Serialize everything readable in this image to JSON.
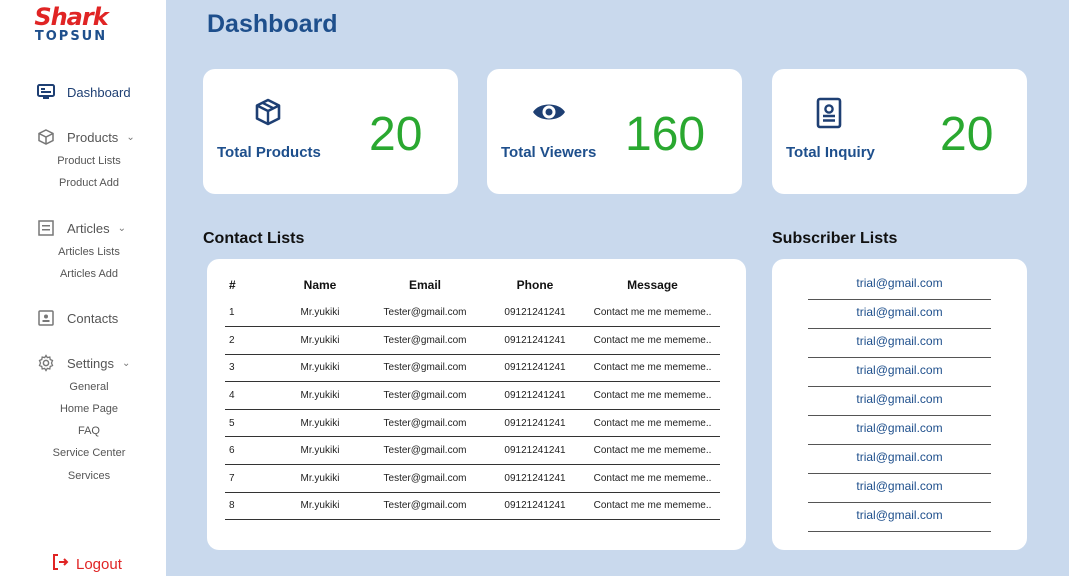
{
  "logo": {
    "main": "Shark",
    "sub": "TOPSUN"
  },
  "sidebar": {
    "items": [
      {
        "label": "Dashboard",
        "icon": "dashboard-monitor-icon"
      },
      {
        "label": "Products",
        "icon": "box-icon",
        "sub": [
          "Product Lists",
          "Product Add"
        ]
      },
      {
        "label": "Articles",
        "icon": "article-icon",
        "sub": [
          "Articles Lists",
          "Articles Add"
        ]
      },
      {
        "label": "Contacts",
        "icon": "contact-card-icon"
      },
      {
        "label": "Settings",
        "icon": "gear-icon",
        "sub": [
          "General",
          "Home Page",
          "FAQ",
          "Service Center",
          "Services"
        ]
      }
    ],
    "logout": "Logout"
  },
  "page": {
    "title": "Dashboard"
  },
  "cards": [
    {
      "label": "Total Products",
      "value": "20",
      "icon": "box-icon"
    },
    {
      "label": "Total Viewers",
      "value": "160",
      "icon": "eye-icon"
    },
    {
      "label": "Total Inquiry",
      "value": "20",
      "icon": "clipboard-user-icon"
    }
  ],
  "contacts": {
    "title": "Contact Lists",
    "columns": [
      "#",
      "Name",
      "Email",
      "Phone",
      "Message"
    ],
    "rows": [
      [
        "1",
        "Mr.yukiki",
        "Tester@gmail.com",
        "09121241241",
        "Contact me me mememe.."
      ],
      [
        "2",
        "Mr.yukiki",
        "Tester@gmail.com",
        "09121241241",
        "Contact me me mememe.."
      ],
      [
        "3",
        "Mr.yukiki",
        "Tester@gmail.com",
        "09121241241",
        "Contact me me mememe.."
      ],
      [
        "4",
        "Mr.yukiki",
        "Tester@gmail.com",
        "09121241241",
        "Contact me me mememe.."
      ],
      [
        "5",
        "Mr.yukiki",
        "Tester@gmail.com",
        "09121241241",
        "Contact me me mememe.."
      ],
      [
        "6",
        "Mr.yukiki",
        "Tester@gmail.com",
        "09121241241",
        "Contact me me mememe.."
      ],
      [
        "7",
        "Mr.yukiki",
        "Tester@gmail.com",
        "09121241241",
        "Contact me me mememe.."
      ],
      [
        "8",
        "Mr.yukiki",
        "Tester@gmail.com",
        "09121241241",
        "Contact me me mememe.."
      ]
    ]
  },
  "subscribers": {
    "title": "Subscriber Lists",
    "emails": [
      "trial@gmail.com",
      "trial@gmail.com",
      "trial@gmail.com",
      "trial@gmail.com",
      "trial@gmail.com",
      "trial@gmail.com",
      "trial@gmail.com",
      "trial@gmail.com",
      "trial@gmail.com"
    ]
  },
  "colors": {
    "accent": "#1e4f8c",
    "value_green": "#2aa830",
    "logout_red": "#e02424",
    "background": "#c9d9ed"
  }
}
